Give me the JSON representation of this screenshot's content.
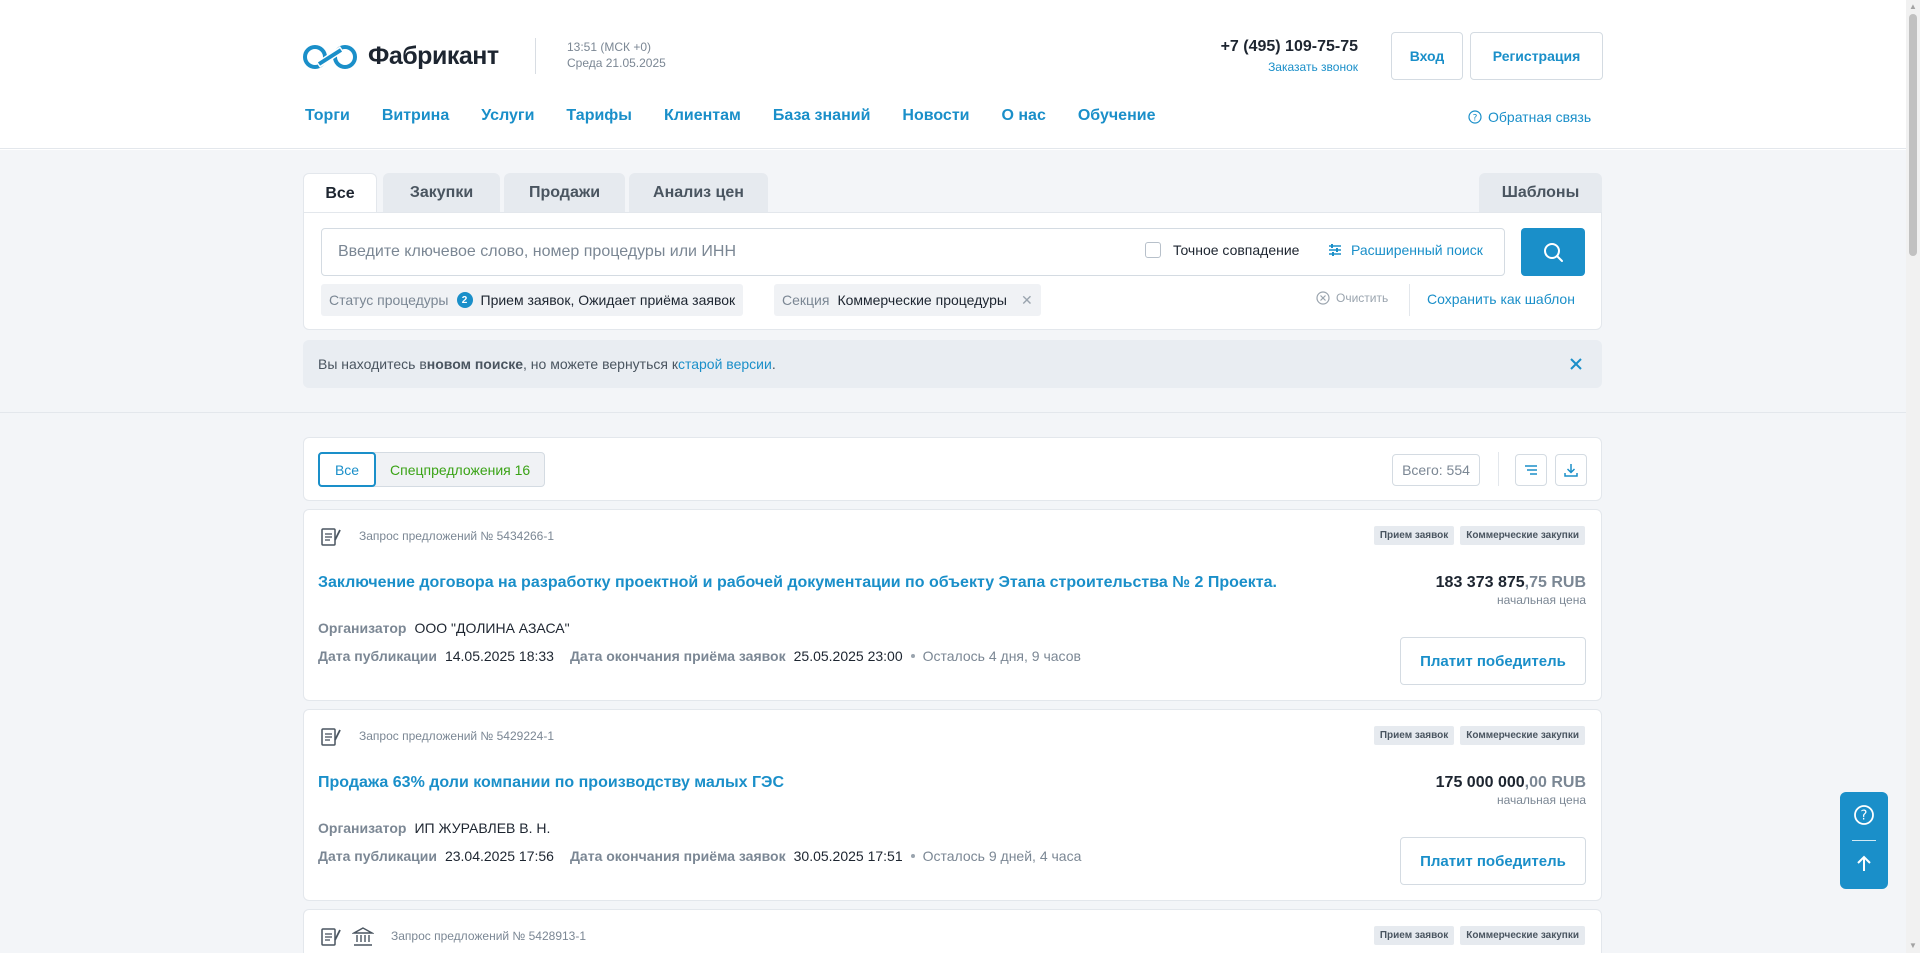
{
  "header": {
    "logo_text": "Фабрикант",
    "time": "13:51 (МСК +0)",
    "date": "Среда 21.05.2025",
    "phone": "+7 (495) 109-75-75",
    "callback": "Заказать звонок",
    "login": "Вход",
    "register": "Регистрация",
    "feedback": "Обратная связь",
    "nav": [
      "Торги",
      "Витрина",
      "Услуги",
      "Тарифы",
      "Клиентам",
      "База знаний",
      "Новости",
      "О нас",
      "Обучение"
    ]
  },
  "search": {
    "tabs": [
      "Все",
      "Закупки",
      "Продажи",
      "Анализ цен"
    ],
    "templates_tab": "Шаблоны",
    "placeholder": "Введите ключевое слово, номер процедуры или ИНН",
    "exact_match": "Точное совпадение",
    "advanced": "Расширенный поиск",
    "filters": [
      {
        "key": "Статус процедуры",
        "count": "2",
        "value": "Прием заявок, Ожидает приёма заявок"
      },
      {
        "key": "Секция",
        "value": "Коммерческие процедуры"
      }
    ],
    "clear": "Очистить",
    "save_template": "Сохранить как шаблон"
  },
  "notice": {
    "prefix": "Вы находитесь в ",
    "bold": "новом поиске",
    "middle": ", но можете вернуться к ",
    "link": "старой версии",
    "suffix": "."
  },
  "results": {
    "filter_all": "Все",
    "filter_special": "Спецпредложения 16",
    "total": "Всего: 554",
    "cards": [
      {
        "procedure": "Запрос предложений № 5434266-1",
        "tags": [
          "Прием заявок",
          "Коммерческие закупки"
        ],
        "title": "Заключение договора на разработку проектной и рабочей документации по объекту Этапа строительства № 2 Проекта.",
        "price_int": "183 373 875",
        "price_dec": ",75 RUB",
        "price_label": "начальная цена",
        "organizer_label": "Организатор",
        "organizer": "ООО \"ДОЛИНА АЗАСА\"",
        "pub_label": "Дата публикации",
        "pub_date": "14.05.2025 18:33",
        "end_label": "Дата окончания приёма заявок",
        "end_date": "25.05.2025 23:00",
        "left": "Осталось 4 дня, 9 часов",
        "button": "Платит победитель"
      },
      {
        "procedure": "Запрос предложений № 5429224-1",
        "tags": [
          "Прием заявок",
          "Коммерческие закупки"
        ],
        "title": "Продажа 63% доли компании по производству малых ГЭС",
        "price_int": "175 000 000",
        "price_dec": ",00 RUB",
        "price_label": "начальная цена",
        "organizer_label": "Организатор",
        "organizer": "ИП ЖУРАВЛЕВ В. Н.",
        "pub_label": "Дата публикации",
        "pub_date": "23.04.2025 17:56",
        "end_label": "Дата окончания приёма заявок",
        "end_date": "30.05.2025 17:51",
        "left": "Осталось 9 дней, 4 часа",
        "button": "Платит победитель"
      },
      {
        "procedure": "Запрос предложений № 5428913-1",
        "tags": [
          "Прием заявок",
          "Коммерческие закупки"
        ]
      }
    ]
  },
  "colors": {
    "accent": "#1a8fc9",
    "special": "#3aa316"
  }
}
